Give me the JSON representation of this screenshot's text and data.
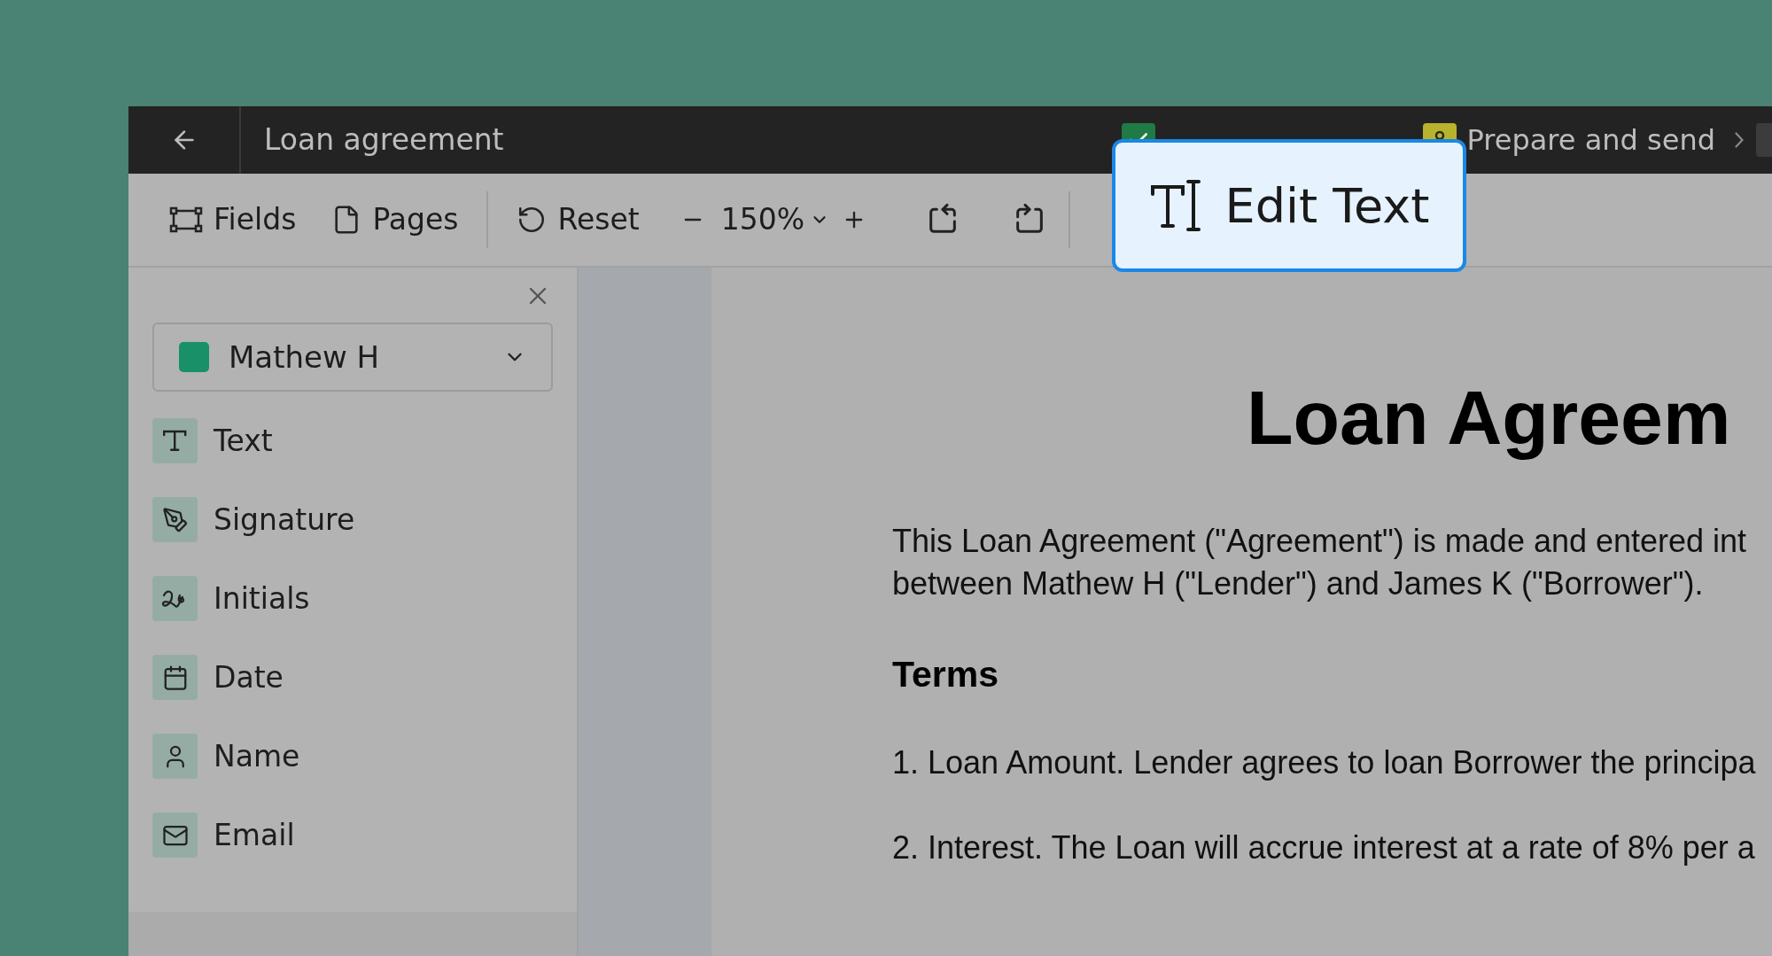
{
  "topbar": {
    "title": "Loan agreement",
    "steps": [
      {
        "kind": "done"
      },
      {
        "kind": "current",
        "label": "Prepare and send"
      },
      {
        "kind": "pending"
      }
    ]
  },
  "toolbar": {
    "items": [
      {
        "kind": "fields",
        "label": "Fields"
      },
      {
        "kind": "pages",
        "label": "Pages"
      },
      {
        "kind": "divider"
      },
      {
        "kind": "reset",
        "label": "Reset"
      },
      {
        "kind": "zoom",
        "value": "150%"
      },
      {
        "kind": "rotate-left"
      },
      {
        "kind": "rotate-right"
      },
      {
        "kind": "divider"
      }
    ]
  },
  "popup": {
    "label": "Edit Text"
  },
  "sidebar": {
    "signer": {
      "name": "Mathew H",
      "color": "#1a9068"
    },
    "fields": [
      {
        "kind": "text",
        "label": "Text"
      },
      {
        "kind": "signature",
        "label": "Signature"
      },
      {
        "kind": "initials",
        "label": "Initials"
      },
      {
        "kind": "date",
        "label": "Date"
      },
      {
        "kind": "name",
        "label": "Name"
      },
      {
        "kind": "email",
        "label": "Email"
      }
    ]
  },
  "document": {
    "title": "Loan Agreem",
    "intro": [
      "This Loan Agreement (\"Agreement\") is made and entered int",
      "between Mathew H (\"Lender\") and James K (\"Borrower\")."
    ],
    "heading": "Terms",
    "paragraphs": [
      "1. Loan Amount. Lender agrees to loan Borrower the principa",
      "2. Interest. The Loan will accrue interest at a rate of 8% per a"
    ]
  }
}
